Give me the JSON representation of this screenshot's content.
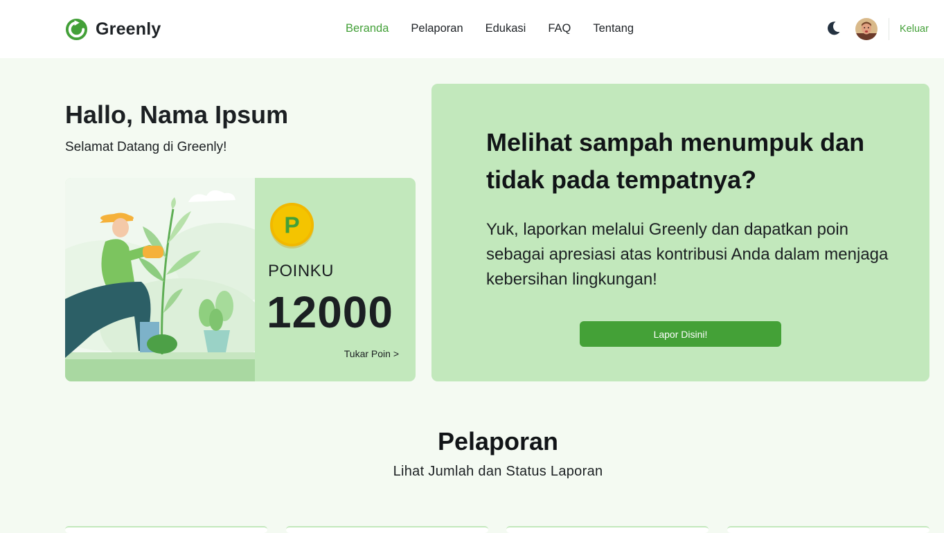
{
  "header": {
    "brand": "Greenly",
    "nav": [
      "Beranda",
      "Pelaporan",
      "Edukasi",
      "FAQ",
      "Tentang"
    ],
    "active_nav": "Beranda",
    "logout_label": "Keluar",
    "theme_icon": "moon-icon",
    "accent_color": "#43a038"
  },
  "greeting": {
    "title": "Hallo, Nama Ipsum",
    "subtitle": "Selamat Datang di Greenly!"
  },
  "points": {
    "coin_letter": "P",
    "label": "POINKU",
    "value": "12000",
    "redeem_label": "Tukar Poin >"
  },
  "cta": {
    "title": "Melihat sampah menumpuk dan tidak pada tempatnya?",
    "text": "Yuk, laporkan melalui Greenly dan dapatkan poin sebagai apresiasi atas kontribusi Anda dalam menjaga kebersihan lingkungan!",
    "button_label": "Lapor Disini!",
    "card_color": "#c2e8bc",
    "button_color": "#44a137"
  },
  "reports": {
    "title": "Pelaporan",
    "subtitle": "Lihat Jumlah dan Status Laporan"
  }
}
